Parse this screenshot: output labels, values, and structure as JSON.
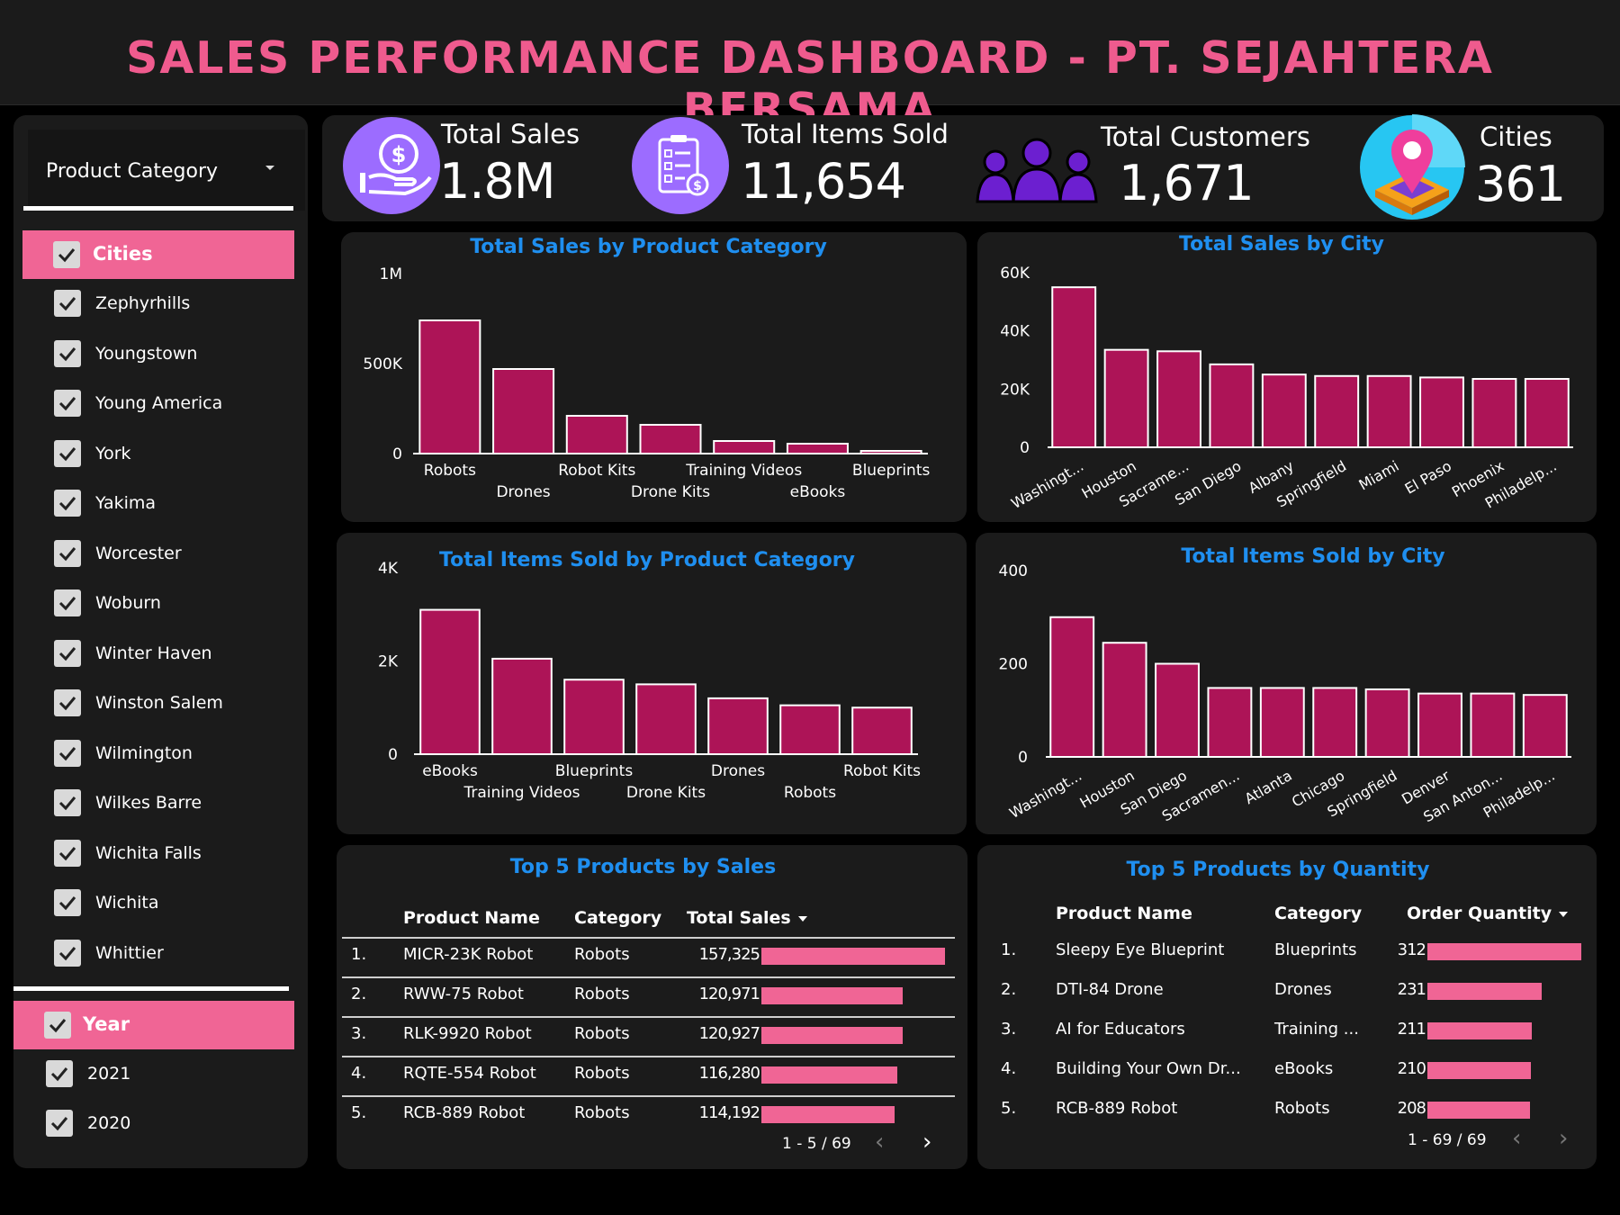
{
  "header": {
    "title": "SALES PERFORMANCE DASHBOARD - PT. SEJAHTERA BERSAMA"
  },
  "colors": {
    "accent_pink": "#f06595",
    "bar": "#ad1457",
    "title_blue": "#1f8ff0",
    "panel": "#1b1b1b"
  },
  "sidebar": {
    "dropdown_label": "Product Category",
    "cities": {
      "header": "Cities",
      "items": [
        "Zephyrhills",
        "Youngstown",
        "Young America",
        "York",
        "Yakima",
        "Worcester",
        "Woburn",
        "Winter Haven",
        "Winston Salem",
        "Wilmington",
        "Wilkes Barre",
        "Wichita Falls",
        "Wichita",
        "Whittier"
      ]
    },
    "year": {
      "header": "Year",
      "items": [
        "2021",
        "2020"
      ]
    }
  },
  "kpis": {
    "total_sales": {
      "label": "Total Sales",
      "value": "1.8M",
      "icon": "money-hand-icon"
    },
    "total_items": {
      "label": "Total Items Sold",
      "value": "11,654",
      "icon": "checklist-icon"
    },
    "total_customers": {
      "label": "Total Customers",
      "value": "1,671",
      "icon": "people-group-icon"
    },
    "cities": {
      "label": "Cities",
      "value": "361",
      "icon": "map-pin-icon"
    }
  },
  "chart_data": [
    {
      "id": "sales_by_category",
      "type": "bar",
      "title": "Total Sales by Product Category",
      "categories": [
        "Robots",
        "Drones",
        "Robot Kits",
        "Drone Kits",
        "Training Videos",
        "eBooks",
        "Blueprints"
      ],
      "values": [
        740000,
        470000,
        210000,
        160000,
        70000,
        55000,
        15000
      ],
      "ylim": [
        0,
        1000000
      ],
      "yticks": [
        "0",
        "500K",
        "1M"
      ],
      "ytick_values": [
        0,
        500000,
        1000000
      ]
    },
    {
      "id": "sales_by_city",
      "type": "bar",
      "title": "Total Sales by City",
      "categories": [
        "Washingt...",
        "Houston",
        "Sacrame...",
        "San Diego",
        "Albany",
        "Springfield",
        "Miami",
        "El Paso",
        "Phoenix",
        "Philadelp..."
      ],
      "values": [
        55000,
        33500,
        33000,
        28500,
        25000,
        24500,
        24500,
        24000,
        23500,
        23500
      ],
      "ylim": [
        0,
        60000
      ],
      "yticks": [
        "0",
        "20K",
        "40K",
        "60K"
      ],
      "ytick_values": [
        0,
        20000,
        40000,
        60000
      ]
    },
    {
      "id": "items_by_category",
      "type": "bar",
      "title": "Total Items Sold by Product Category",
      "categories": [
        "eBooks",
        "Training Videos",
        "Blueprints",
        "Drone Kits",
        "Drones",
        "Robots",
        "Robot Kits"
      ],
      "values": [
        3100,
        2050,
        1600,
        1500,
        1200,
        1050,
        1000
      ],
      "ylim": [
        0,
        4000
      ],
      "yticks": [
        "0",
        "2K",
        "4K"
      ],
      "ytick_values": [
        0,
        2000,
        4000
      ]
    },
    {
      "id": "items_by_city",
      "type": "bar",
      "title": "Total Items Sold by City",
      "categories": [
        "Washingt...",
        "Houston",
        "San Diego",
        "Sacramen...",
        "Atlanta",
        "Chicago",
        "Springfield",
        "Denver",
        "San Anton...",
        "Philadelp..."
      ],
      "values": [
        300,
        245,
        200,
        148,
        148,
        148,
        145,
        136,
        136,
        133
      ],
      "ylim": [
        0,
        400
      ],
      "yticks": [
        "0",
        "200",
        "400"
      ],
      "ytick_values": [
        0,
        200,
        400
      ]
    }
  ],
  "top_sales": {
    "title": "Top 5 Products by Sales",
    "headers": {
      "name": "Product Name",
      "category": "Category",
      "value": "Total Sales"
    },
    "rows": [
      {
        "rank": "1.",
        "name": "MICR-23K Robot",
        "category": "Robots",
        "value": "157,325",
        "amount": 157325
      },
      {
        "rank": "2.",
        "name": "RWW-75 Robot",
        "category": "Robots",
        "value": "120,971",
        "amount": 120971
      },
      {
        "rank": "3.",
        "name": "RLK-9920 Robot",
        "category": "Robots",
        "value": "120,927",
        "amount": 120927
      },
      {
        "rank": "4.",
        "name": "RQTE-554 Robot",
        "category": "Robots",
        "value": "116,280",
        "amount": 116280
      },
      {
        "rank": "5.",
        "name": "RCB-889 Robot",
        "category": "Robots",
        "value": "114,192",
        "amount": 114192
      }
    ],
    "pager": "1 - 5 / 69"
  },
  "top_quantity": {
    "title": "Top 5 Products by Quantity",
    "headers": {
      "name": "Product Name",
      "category": "Category",
      "value": "Order Quantity"
    },
    "rows": [
      {
        "rank": "1.",
        "name": "Sleepy Eye Blueprint",
        "category": "Blueprints",
        "value": "312",
        "amount": 312
      },
      {
        "rank": "2.",
        "name": "DTI-84 Drone",
        "category": "Drones",
        "value": "231",
        "amount": 231
      },
      {
        "rank": "3.",
        "name": "AI for Educators",
        "category": "Training ...",
        "value": "211",
        "amount": 211
      },
      {
        "rank": "4.",
        "name": "Building Your Own Dr...",
        "category": "eBooks",
        "value": "210",
        "amount": 210
      },
      {
        "rank": "5.",
        "name": "RCB-889 Robot",
        "category": "Robots",
        "value": "208",
        "amount": 208
      }
    ],
    "pager": "1 - 69 / 69"
  }
}
